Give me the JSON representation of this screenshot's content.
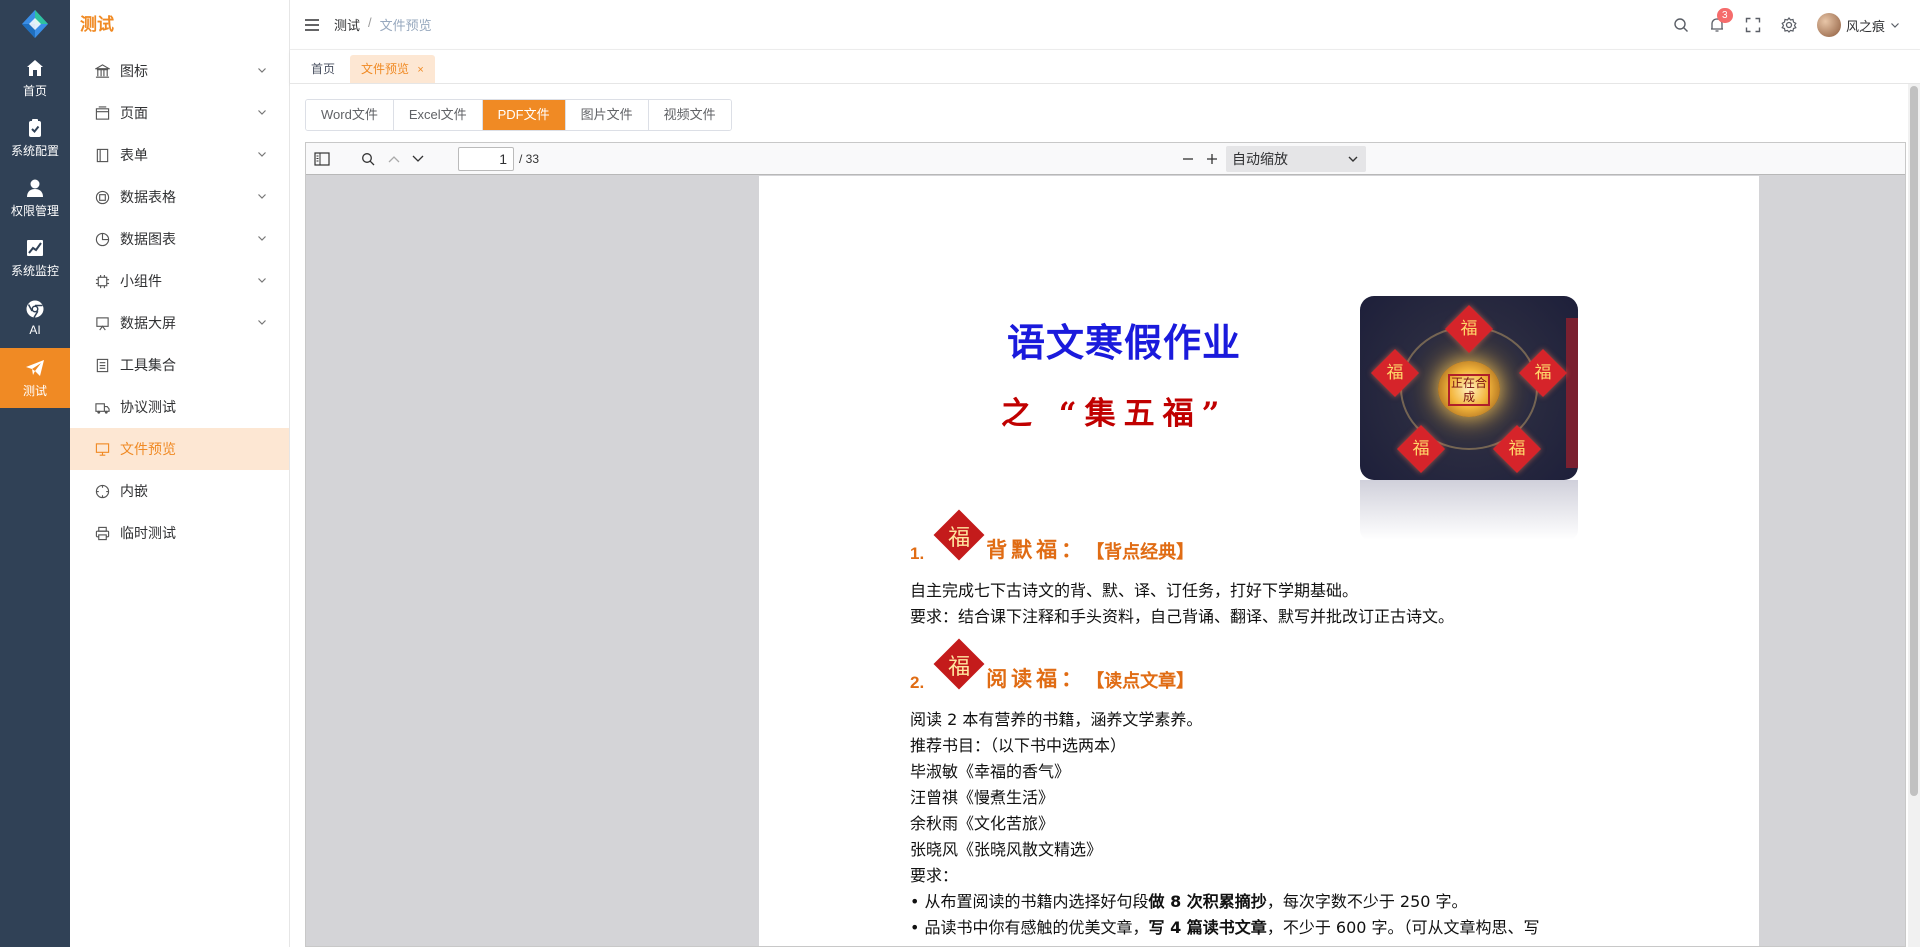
{
  "rail": {
    "items": [
      {
        "label": "首页",
        "icon": "home-icon"
      },
      {
        "label": "系统配置",
        "icon": "clipboard-check-icon"
      },
      {
        "label": "权限管理",
        "icon": "user-icon"
      },
      {
        "label": "系统监控",
        "icon": "line-chart-icon"
      },
      {
        "label": "AI",
        "icon": "chrome-icon"
      },
      {
        "label": "测试",
        "icon": "paper-plane-icon",
        "active": true
      }
    ]
  },
  "sidebar": {
    "title": "测试",
    "items": [
      {
        "label": "图标",
        "icon": "bank-icon",
        "expandable": true
      },
      {
        "label": "页面",
        "icon": "window-icon",
        "expandable": true
      },
      {
        "label": "表单",
        "icon": "notebook-icon",
        "expandable": true
      },
      {
        "label": "数据表格",
        "icon": "grid-icon",
        "expandable": true
      },
      {
        "label": "数据图表",
        "icon": "pie-chart-icon",
        "expandable": true
      },
      {
        "label": "小组件",
        "icon": "cpu-icon",
        "expandable": true
      },
      {
        "label": "数据大屏",
        "icon": "easel-icon",
        "expandable": true
      },
      {
        "label": "工具集合",
        "icon": "list-icon"
      },
      {
        "label": "协议测试",
        "icon": "truck-icon"
      },
      {
        "label": "文件预览",
        "icon": "monitor-icon",
        "active": true
      },
      {
        "label": "内嵌",
        "icon": "compass-icon"
      },
      {
        "label": "临时测试",
        "icon": "printer-icon"
      }
    ]
  },
  "header": {
    "breadcrumb": [
      "测试",
      "文件预览"
    ],
    "separator": "/",
    "notification_count": "3",
    "username": "风之痕"
  },
  "tags": {
    "items": [
      {
        "label": "首页"
      },
      {
        "label": "文件预览",
        "active": true,
        "closable": true
      }
    ],
    "close_glyph": "×"
  },
  "file_tabs": {
    "items": [
      "Word文件",
      "Excel文件",
      "PDF文件",
      "图片文件",
      "视频文件"
    ],
    "active_index": 2
  },
  "pdf_viewer": {
    "current_page": "1",
    "total_pages": "/ 33",
    "zoom": "自动缩放"
  },
  "document": {
    "title": "语文寒假作业",
    "subtitle": "之 “集五福”",
    "image_center_text": "正在合成",
    "image_fu": "福",
    "sections": [
      {
        "number": "1.",
        "mark": "福",
        "label": "背默福：",
        "tag": "【背点经典】"
      },
      {
        "number": "2.",
        "mark": "福",
        "label": "阅读福：",
        "tag": "【读点文章】"
      }
    ],
    "lines_s1": [
      "自主完成七下古诗文的背、默、译、订任务，打好下学期基础。",
      "要求：结合课下注释和手头资料，自己背诵、翻译、默写并批改订正古诗文。"
    ],
    "lines_s2": [
      "阅读 2 本有营养的书籍，涵养文学素养。",
      "推荐书目：（以下书中选两本）",
      "毕淑敏《幸福的香气》",
      "汪曾祺《慢煮生活》",
      "余秋雨《文化苦旅》",
      "张晓风《张晓风散文精选》",
      "要求："
    ],
    "bullet1_pre": "• 从布置阅读的书籍内选择好句段",
    "bullet1_bold": "做 8 次积累摘抄",
    "bullet1_post": "，每次字数不少于 250 字。",
    "bullet2_pre": "• 品读书中你有感触的优美文章，",
    "bullet2_bold": "写 4 篇读书文章",
    "bullet2_post": "，不少于 600 字。（可从文章构思、写"
  }
}
